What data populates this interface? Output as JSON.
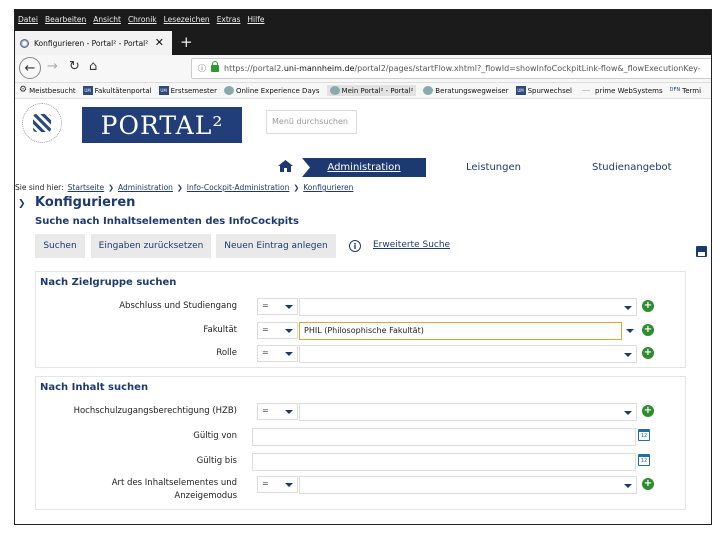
{
  "browser": {
    "menu": [
      "Datei",
      "Bearbeiten",
      "Ansicht",
      "Chronik",
      "Lesezeichen",
      "Extras",
      "Hilfe"
    ],
    "tab_title": "Konfigurieren - Portal² - Portal²",
    "url_prefix": "https://portal2.",
    "url_domain": "uni-mannheim.de",
    "url_rest": "/portal2/pages/startFlow.xhtml?_flowId=showInfoCockpitLink-flow&_flowExecutionKey-",
    "bookmarks": [
      {
        "label": "Meistbesucht",
        "icon": "gear-icon"
      },
      {
        "label": "Fakultätenportal",
        "icon": "uni-icon"
      },
      {
        "label": "Erstsemester",
        "icon": "uni-icon"
      },
      {
        "label": "Online Experience Days",
        "icon": "seal-icon"
      },
      {
        "label": "Mein Portal² - Portal²",
        "icon": "seal-icon"
      },
      {
        "label": "Beratungswegweiser",
        "icon": "seal-icon"
      },
      {
        "label": "Spurwechsel",
        "icon": "uni-icon"
      },
      {
        "label": "prime WebSystems",
        "icon": "prime-icon"
      },
      {
        "label": "Termi",
        "icon": "dfn-icon"
      }
    ]
  },
  "header": {
    "logo_text": "PORTAL²",
    "menu_search_placeholder": "Menü durchsuchen",
    "nav": {
      "admin": "Administration",
      "leistungen": "Leistungen",
      "studienangebot": "Studienangebot"
    }
  },
  "breadcrumb": {
    "prefix": "Sie sind hier:",
    "items": [
      "Startseite",
      "Administration",
      "Info-Cockpit-Administration",
      "Konfigurieren"
    ]
  },
  "page": {
    "title": "Konfigurieren",
    "subtitle": "Suche nach Inhaltselementen des InfoCockpits"
  },
  "toolbar": {
    "search": "Suchen",
    "reset": "Eingaben zurücksetzen",
    "new_entry": "Neuen Eintrag anlegen",
    "info_glyph": "i",
    "advanced": "Erweiterte Suche"
  },
  "section_target": {
    "title": "Nach Zielgruppe suchen",
    "rows": [
      {
        "label": "Abschluss und Studiengang",
        "op": "=",
        "value": ""
      },
      {
        "label": "Fakultät",
        "op": "=",
        "value": "PHIL (Philosophische Fakultät)"
      },
      {
        "label": "Rolle",
        "op": "=",
        "value": ""
      }
    ]
  },
  "section_content": {
    "title": "Nach Inhalt suchen",
    "hzb": {
      "label": "Hochschulzugangsberechtigung (HZB)",
      "op": "=",
      "value": ""
    },
    "valid_from": {
      "label": "Gültig von",
      "value": ""
    },
    "valid_to": {
      "label": "Gültig bis",
      "value": ""
    },
    "type_label_1": "Art des Inhaltselementes und",
    "type_label_2": "Anzeigemodus",
    "type_op": "=",
    "type_value": ""
  },
  "icons": {
    "plus_glyph": "+",
    "calendar_glyph": "12"
  }
}
